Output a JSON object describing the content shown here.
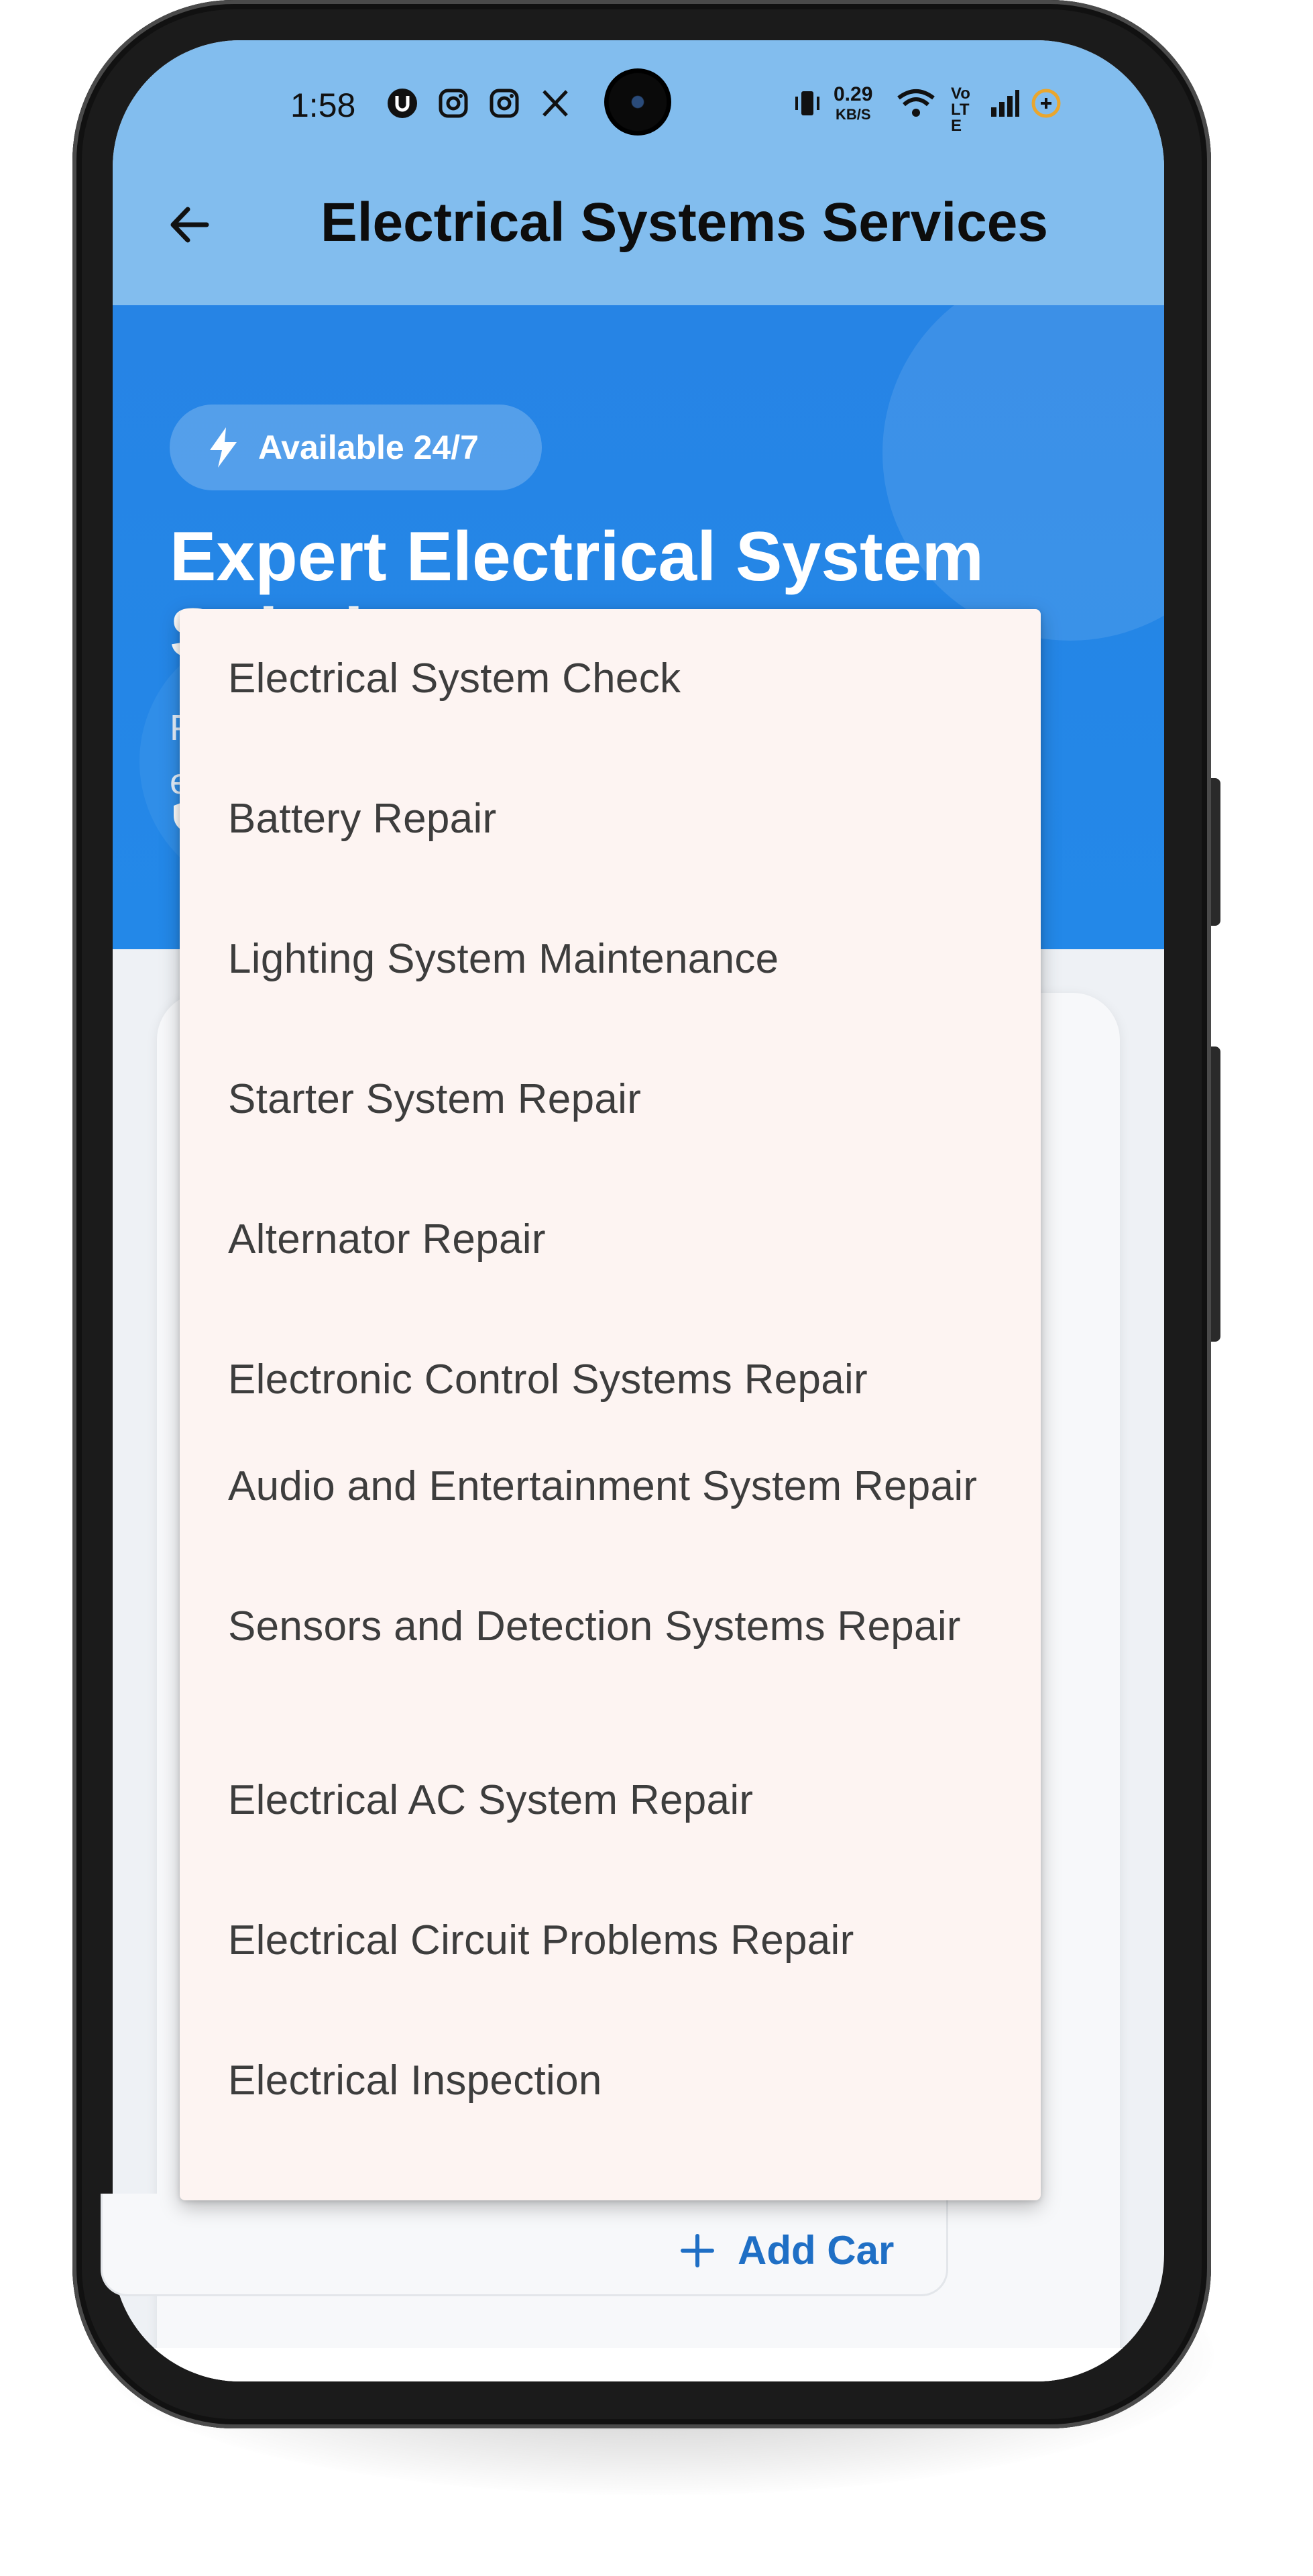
{
  "status_bar": {
    "time": "1:58",
    "speed_value": "0.29",
    "speed_unit": "KB/S",
    "network_label": "Vo LTE",
    "icons": [
      "u-notification-icon",
      "instagram-icon",
      "instagram-icon",
      "x-icon",
      "vibrate-icon",
      "wifi-icon",
      "signal-icon",
      "battery-icon"
    ]
  },
  "app_bar": {
    "title": "Electrical Systems Services",
    "back_icon": "arrow-left-icon"
  },
  "hero": {
    "badge": "Available 24/7",
    "badge_icon": "lightning-icon",
    "title": "Expert Electrical System Solutions",
    "subtitle_line1": "Pro",
    "subtitle_line2": "ele",
    "feature_icon": "shield-icon"
  },
  "dropdown": {
    "items": [
      "Electrical System Check",
      "Battery Repair",
      "Lighting System Maintenance",
      "Starter System Repair",
      "Alternator Repair",
      "Electronic Control Systems Repair",
      "Audio and Entertainment System Repair",
      "Sensors and Detection Systems Repair",
      "Electrical AC System Repair",
      "Electrical Circuit Problems Repair",
      "Electrical Inspection"
    ]
  },
  "car_section": {
    "add_car_label": "Add Car",
    "add_icon": "plus-icon"
  },
  "colors": {
    "app_bar": "#82bdee",
    "hero": "#2388e8",
    "accent": "#1f6fc5",
    "dropdown_bg": "#fdf4f2"
  }
}
